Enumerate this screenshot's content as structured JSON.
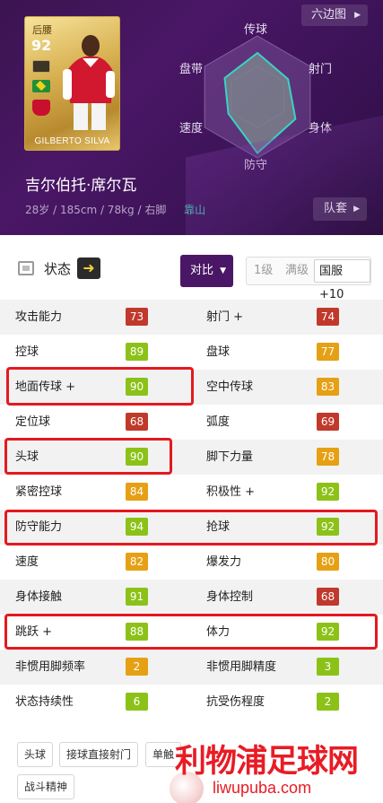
{
  "header": {
    "card": {
      "position": "后腰",
      "rating": "92",
      "name": "GILBERTO SILVA"
    },
    "hexagon_button": "六边图",
    "radar": {
      "labels": {
        "top": "传球",
        "top_right": "射门",
        "bottom_right": "身体",
        "bottom": "防守",
        "bottom_left": "速度",
        "top_left": "盘带"
      },
      "levels": {
        "传球": 0.72,
        "射门": 0.58,
        "身体": 0.72,
        "防守": 0.92,
        "速度": 0.55,
        "盘带": 0.62
      },
      "fill_color": "#7f8c8d",
      "line_color": "#39d3c4"
    },
    "player_name": "吉尔伯托·席尔瓦",
    "player_info": "28岁 / 185cm / 78kg / 右脚",
    "lean_text": "靠山",
    "team_button": "队套"
  },
  "status": {
    "label": "状态",
    "compare_button": "对比",
    "levels": [
      "1级",
      "满级",
      "国服+10"
    ]
  },
  "stats": [
    {
      "left": {
        "name": "攻击能力",
        "value": "73",
        "color": "#c0392b"
      },
      "right": {
        "name": "射门 +",
        "value": "74",
        "color": "#c0392b"
      }
    },
    {
      "left": {
        "name": "控球",
        "value": "89",
        "color": "#8cc218"
      },
      "right": {
        "name": "盘球",
        "value": "77",
        "color": "#e6a014"
      }
    },
    {
      "left": {
        "name": "地面传球 +",
        "value": "90",
        "color": "#8cc218"
      },
      "right": {
        "name": "空中传球",
        "value": "83",
        "color": "#e6a014"
      }
    },
    {
      "left": {
        "name": "定位球",
        "value": "68",
        "color": "#c0392b"
      },
      "right": {
        "name": "弧度",
        "value": "69",
        "color": "#c0392b"
      }
    },
    {
      "left": {
        "name": "头球",
        "value": "90",
        "color": "#8cc218"
      },
      "right": {
        "name": "脚下力量",
        "value": "78",
        "color": "#e6a014"
      }
    },
    {
      "left": {
        "name": "紧密控球",
        "value": "84",
        "color": "#e6a014"
      },
      "right": {
        "name": "积极性 +",
        "value": "92",
        "color": "#8cc218"
      }
    },
    {
      "left": {
        "name": "防守能力",
        "value": "94",
        "color": "#8cc218"
      },
      "right": {
        "name": "抢球",
        "value": "92",
        "color": "#8cc218"
      }
    },
    {
      "left": {
        "name": "速度",
        "value": "82",
        "color": "#e6a014"
      },
      "right": {
        "name": "爆发力",
        "value": "80",
        "color": "#e6a014"
      }
    },
    {
      "left": {
        "name": "身体接触",
        "value": "91",
        "color": "#8cc218"
      },
      "right": {
        "name": "身体控制",
        "value": "68",
        "color": "#c0392b"
      }
    },
    {
      "left": {
        "name": "跳跃 +",
        "value": "88",
        "color": "#8cc218"
      },
      "right": {
        "name": "体力",
        "value": "92",
        "color": "#8cc218"
      }
    },
    {
      "left": {
        "name": "非惯用脚频率",
        "value": "2",
        "color": "#e6a014"
      },
      "right": {
        "name": "非惯用脚精度",
        "value": "3",
        "color": "#8cc218"
      }
    },
    {
      "left": {
        "name": "状态持续性",
        "value": "6",
        "color": "#8cc218"
      },
      "right": {
        "name": "抗受伤程度",
        "value": "2",
        "color": "#8cc218"
      }
    }
  ],
  "tags": [
    "头球",
    "接球直接射门",
    "单触",
    "战斗精神"
  ],
  "watermark": {
    "text": "利物浦足球网",
    "url": "liwupuba.com"
  }
}
